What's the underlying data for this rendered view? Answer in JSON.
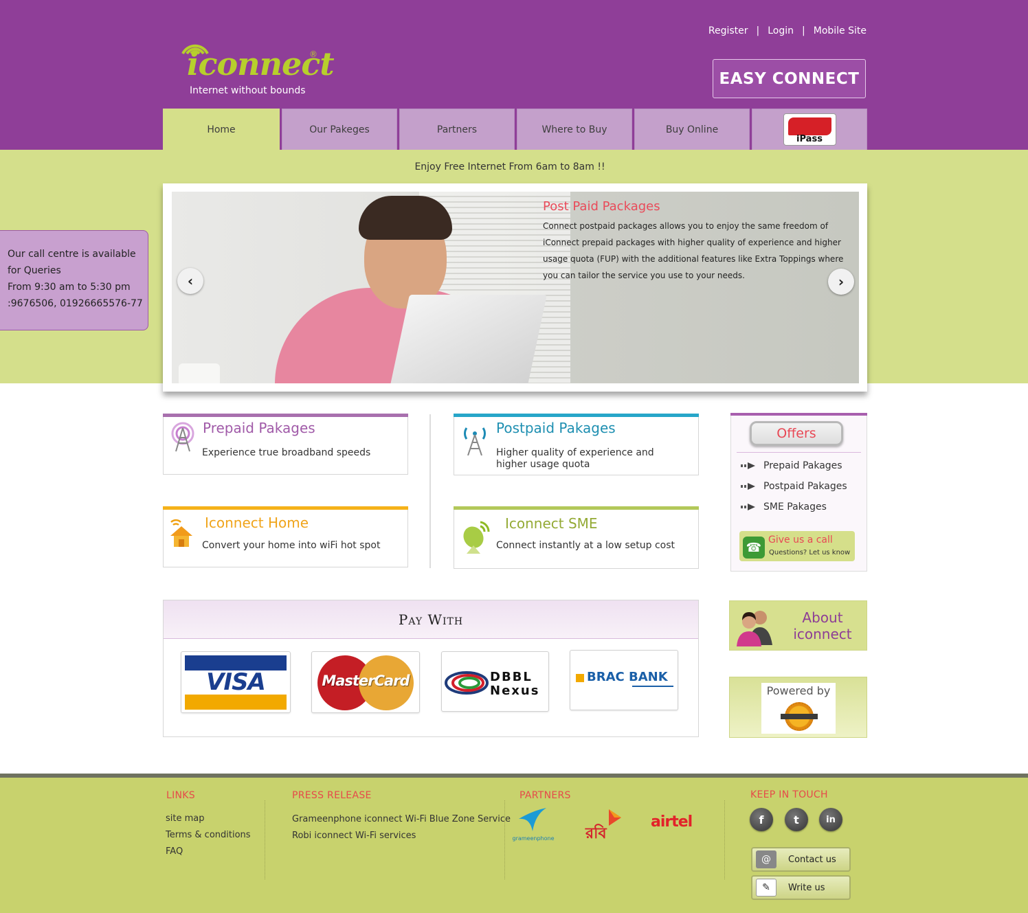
{
  "header": {
    "logo_text": "iconnect",
    "logo_tagline": "Internet without bounds",
    "top_links": [
      "Register",
      "Login",
      "Mobile Site"
    ],
    "link_separator": "|",
    "easy_connect_label": "EASY CONNECT"
  },
  "nav": {
    "tabs": [
      "Home",
      "Our Pakeges",
      "Partners",
      "Where to Buy",
      "Buy Online"
    ],
    "ipass_label": "iPass"
  },
  "banner": {
    "free_message": "Enjoy Free Internet From 6am to 8am !!",
    "slide_title": "Post Paid Packages",
    "slide_text": "Connect postpaid packages allows you to enjoy the same freedom of iConnect prepaid packages with higher quality of experience and higher usage quota (FUP) with the additional features like Extra Toppings where you can tailor the service you use to your needs.",
    "prev_arrow": "‹",
    "next_arrow": "›"
  },
  "callcentre": {
    "line1": "Our call centre is available",
    "line2": "for Queries",
    "line3": "From 9:30 am to 5:30 pm",
    "line4": ":9676506, 01926665576-77"
  },
  "packages": {
    "prepaid": {
      "title": "Prepaid Pakages",
      "desc": "Experience true broadband speeds"
    },
    "postpaid": {
      "title": "Postpaid Pakages",
      "desc": "Higher quality of experience and higher usage quota"
    },
    "home": {
      "title": "Iconnect Home",
      "desc": "Convert your home into wiFi hot spot"
    },
    "sme": {
      "title": "Iconnect SME",
      "desc": "Connect instantly at a low setup cost"
    }
  },
  "offers": {
    "title": "Offers",
    "items": [
      "Prepaid Pakages",
      "Postpaid Pakages",
      "SME Pakages"
    ],
    "give_call": "Give us a call",
    "give_call_sub": "Questions? Let us know"
  },
  "paywith": {
    "title": "Pay With",
    "cards": [
      "VISA",
      "MasterCard",
      "DBBL",
      "Nexus",
      "BRAC BANK"
    ]
  },
  "about": {
    "line1": "About",
    "line2": "iconnect"
  },
  "powered": {
    "label": "Powered by"
  },
  "footer": {
    "links_title": "LINKS",
    "links": [
      "site map",
      "Terms & conditions",
      "FAQ"
    ],
    "press_title": "PRESS RELEASE",
    "press": [
      "Grameenphone iconnect Wi-Fi Blue Zone Service",
      "Robi iconnect Wi-Fi services"
    ],
    "partners_title": "PARTNERS",
    "partners": [
      "grameenphone",
      "রবি",
      "airtel"
    ],
    "keep_title": "KEEP IN TOUCH",
    "social": [
      "f",
      "t",
      "in"
    ],
    "contact_label": "Contact us",
    "write_label": "Write us"
  },
  "colors": {
    "brand_purple": "#8f3e98",
    "brand_green": "#d4df8b",
    "accent_red": "#e84855"
  }
}
